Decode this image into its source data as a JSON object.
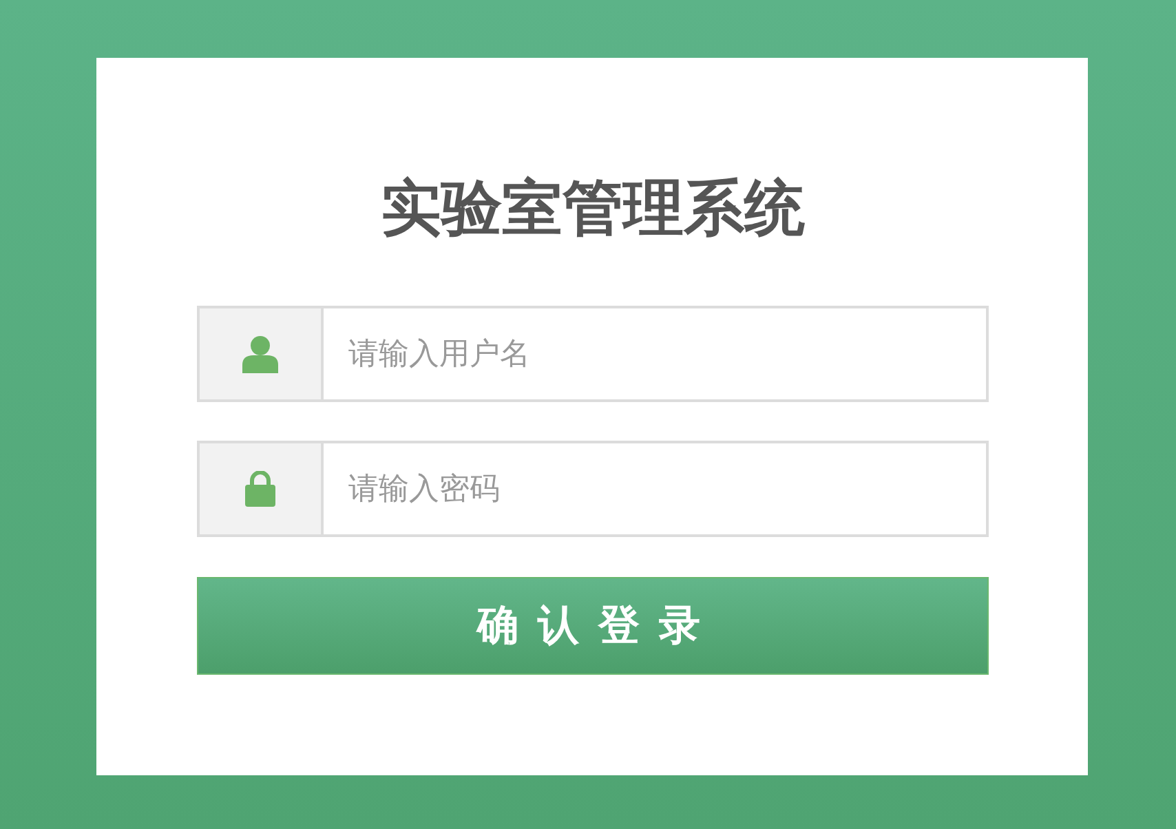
{
  "title": "实验室管理系统",
  "fields": [
    {
      "kind": "user",
      "placeholder": "请输入用户名"
    },
    {
      "kind": "password",
      "placeholder": "请输入密码"
    }
  ],
  "button": "确认登录"
}
